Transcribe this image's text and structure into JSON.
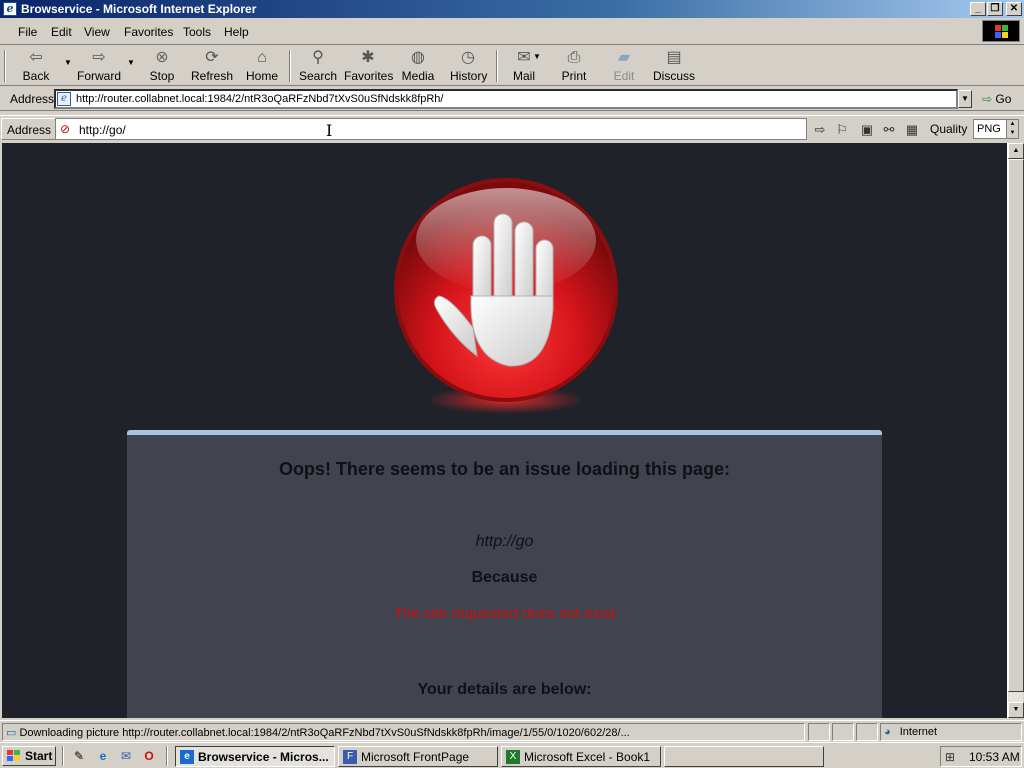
{
  "window": {
    "title": "Browservice - Microsoft Internet Explorer",
    "controls": {
      "minimize": "_",
      "restore": "❐",
      "close": "✕"
    }
  },
  "menu": {
    "items": [
      {
        "label": "File"
      },
      {
        "label": "Edit"
      },
      {
        "label": "View"
      },
      {
        "label": "Favorites"
      },
      {
        "label": "Tools"
      },
      {
        "label": "Help"
      }
    ]
  },
  "toolbar": {
    "back": "Back",
    "forward": "Forward",
    "stop": "Stop",
    "refresh": "Refresh",
    "home": "Home",
    "search": "Search",
    "favorites": "Favorites",
    "media": "Media",
    "history": "History",
    "mail": "Mail",
    "print": "Print",
    "edit": "Edit",
    "discuss": "Discuss"
  },
  "address_bar": {
    "label": "Address",
    "url": "http://router.collabnet.local:1984/2/ntR3oQaRFzNbd7tXvS0uSfNdskk8fpRh/",
    "go_label": "Go"
  },
  "browservice_bar": {
    "label": "Address",
    "url": "http://go/",
    "quality_label": "Quality",
    "quality_value": "PNG"
  },
  "page": {
    "heading": "Oops! There seems to be an issue loading this page:",
    "url": "http://go",
    "because": "Because",
    "reason": "The site requested does not exist",
    "details": "Your details are below:",
    "colors": {
      "background": "#1f2229",
      "panel": "#41434f",
      "panel_border": "#a7c5e3",
      "reason": "#cc1111",
      "stop_red": "#d4141a"
    }
  },
  "status_bar": {
    "message": "Downloading picture http://router.collabnet.local:1984/2/ntR3oQaRFzNbd7tXvS0uSfNdskk8fpRh/image/1/55/0/1020/602/28/...",
    "zone": "Internet"
  },
  "taskbar": {
    "start": "Start",
    "tasks": [
      {
        "label": "Browservice - Micros...",
        "active": true
      },
      {
        "label": "Microsoft FrontPage",
        "active": false
      },
      {
        "label": "Microsoft Excel - Book1",
        "active": false
      }
    ],
    "clock": "10:53 AM"
  }
}
